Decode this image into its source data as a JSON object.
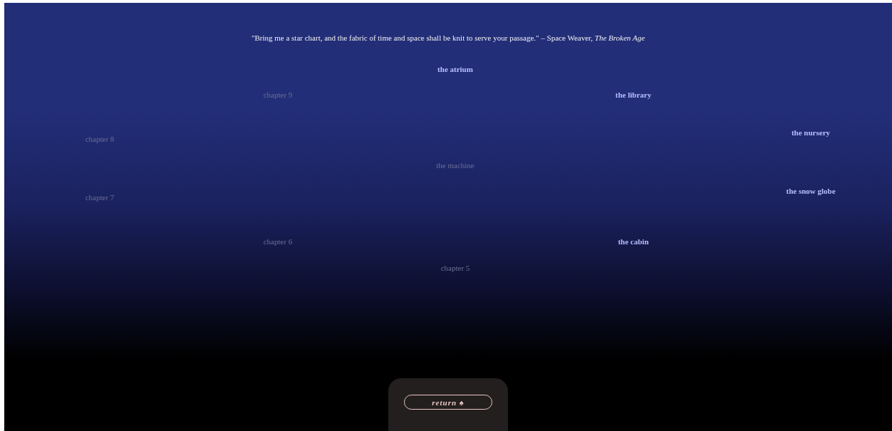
{
  "quote": "\"Bring me a star chart, and the fabric of time and space shall be knit to serve your passage.\" – Space Weaver, *The Broken Age*",
  "nodes": [
    {
      "label": "the atrium",
      "unlocked": true
    },
    {
      "label": "chapter 9",
      "unlocked": false
    },
    {
      "label": "the library",
      "unlocked": true
    },
    {
      "label": "the nursery",
      "unlocked": true
    },
    {
      "label": "chapter 8",
      "unlocked": false
    },
    {
      "label": "the machine",
      "unlocked": false
    },
    {
      "label": "the snow globe",
      "unlocked": true
    },
    {
      "label": "chapter 7",
      "unlocked": false
    },
    {
      "label": "chapter 6",
      "unlocked": false
    },
    {
      "label": "the cabin",
      "unlocked": true
    },
    {
      "label": "chapter 5",
      "unlocked": false
    }
  ],
  "return_button": "return ♠"
}
